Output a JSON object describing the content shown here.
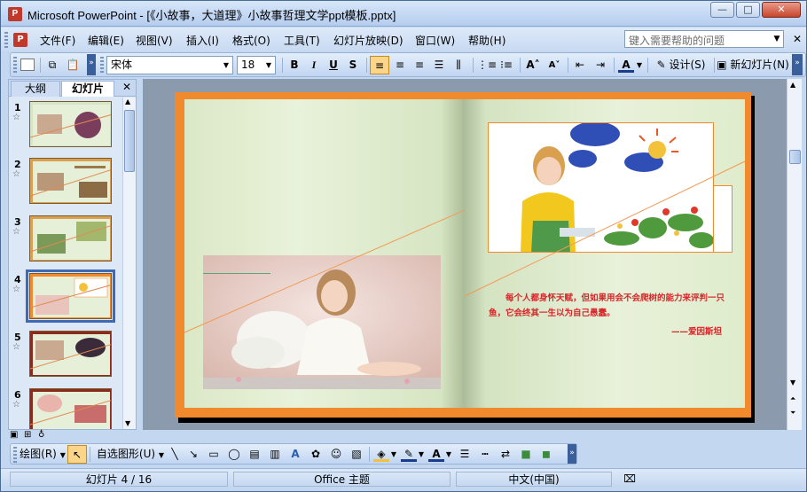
{
  "window": {
    "title": "Microsoft PowerPoint - [《小故事，大道理》小故事哲理文学ppt模板.pptx]",
    "minimize": "—",
    "maximize": "□",
    "close": "✕"
  },
  "menubar": {
    "items": [
      "文件(F)",
      "编辑(E)",
      "视图(V)",
      "插入(I)",
      "格式(O)",
      "工具(T)",
      "幻灯片放映(D)",
      "窗口(W)",
      "帮助(H)"
    ],
    "help_placeholder": "键入需要帮助的问题"
  },
  "toolbar": {
    "font": "宋体",
    "size": "18",
    "bold": "B",
    "italic": "I",
    "underline": "U",
    "shadow": "S",
    "grow": "A˄",
    "shrink": "A˅",
    "font_color": "A",
    "design": "设计(S)",
    "new_slide": "新幻灯片(N)"
  },
  "leftpane": {
    "tabs": [
      "大纲",
      "幻灯片"
    ],
    "close": "✕",
    "thumbnails": [
      {
        "num": "1"
      },
      {
        "num": "2"
      },
      {
        "num": "3"
      },
      {
        "num": "4",
        "selected": true
      },
      {
        "num": "5"
      },
      {
        "num": "6"
      }
    ]
  },
  "slide": {
    "quote_line1": "每个人都身怀天赋，但如果用会不会爬树的能力来评判一只",
    "quote_line2": "鱼，它会终其一生以为自己愚蠢。",
    "author": "——爱因斯坦",
    "colors": {
      "frame": "#f08a2c",
      "page": "#e3eed4",
      "quote": "#d6262a"
    }
  },
  "drawbar": {
    "draw": "绘图(R)",
    "autoshapes": "自选图形(U)"
  },
  "statusbar": {
    "slide_info": "幻灯片 4 / 16",
    "theme": "Office 主题",
    "language": "中文(中国)"
  }
}
